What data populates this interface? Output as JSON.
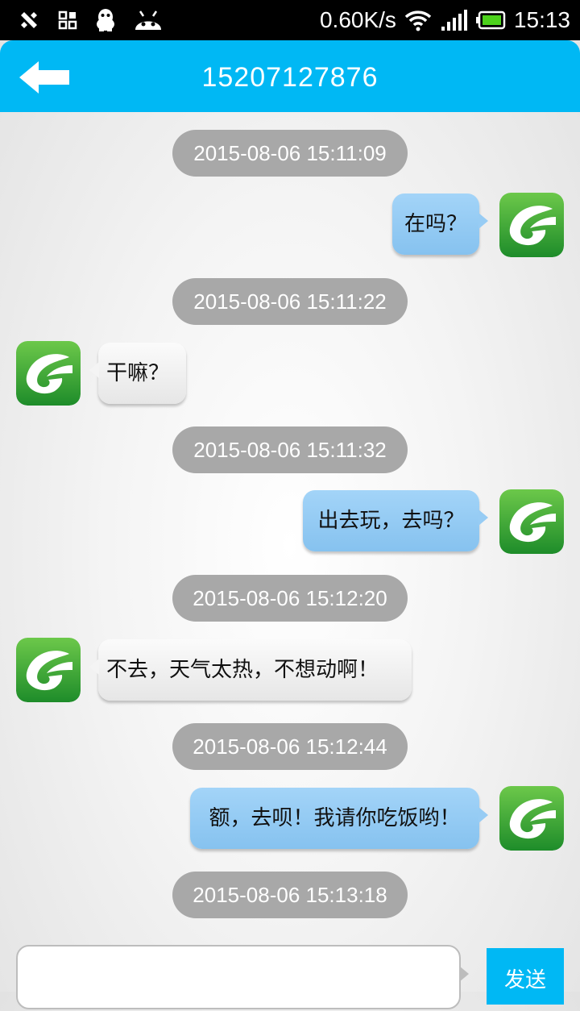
{
  "status_bar": {
    "network_speed": "0.60K/s",
    "time": "15:13",
    "icons": [
      "tools-icon",
      "grid-icon",
      "qq-penguin-icon",
      "android-icon",
      "wifi-icon",
      "signal-icon",
      "battery-icon"
    ]
  },
  "header": {
    "title": "15207127876",
    "back_icon": "back-arrow-icon"
  },
  "timestamps": [
    "2015-08-06 15:11:09",
    "2015-08-06 15:11:22",
    "2015-08-06 15:11:32",
    "2015-08-06 15:12:20",
    "2015-08-06 15:12:44",
    "2015-08-06 15:13:18"
  ],
  "messages": [
    {
      "direction": "out",
      "text": "在吗？"
    },
    {
      "direction": "in",
      "text": "干嘛？"
    },
    {
      "direction": "out",
      "text": "出去玩，去吗？"
    },
    {
      "direction": "in",
      "text": "不去，天气太热，不想动啊！"
    },
    {
      "direction": "out",
      "text": "额，去呗！我请你吃饭哟！"
    }
  ],
  "input": {
    "value": "",
    "send_label": "发送"
  },
  "colors": {
    "header": "#00b8f4",
    "outgoing_bubble": "#8ec7f1",
    "incoming_bubble": "#f0f0f0",
    "timestamp_pill": "#a8a8a8",
    "avatar_green": "#3aaa35"
  }
}
